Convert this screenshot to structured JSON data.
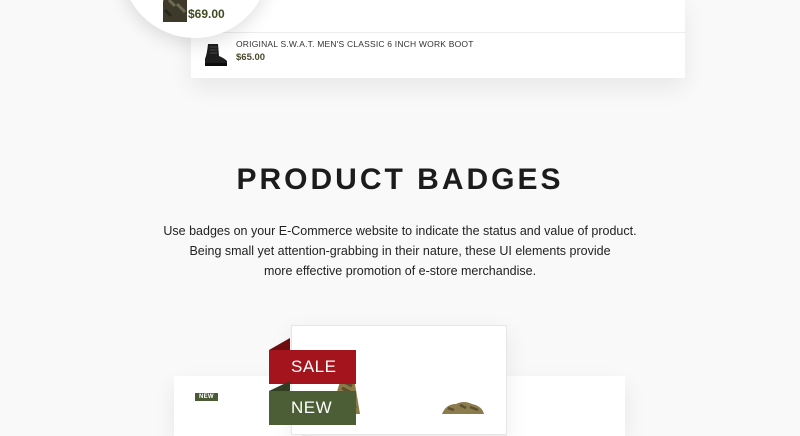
{
  "related_products": {
    "items": [
      {
        "price": "$69.00",
        "partial_price": "00"
      },
      {
        "title": "ORIGINAL S.W.A.T. MEN'S CLASSIC 6 INCH WORK BOOT",
        "price": "$65.00"
      }
    ]
  },
  "badges_section": {
    "title": "PRODUCT BADGES",
    "description_lines": [
      "Use badges on your E-Commerce website to indicate the status and value of product.",
      "Being small yet attention-grabbing in their nature, these UI elements provide",
      "more effective promotion of e-store merchandise."
    ],
    "badges": {
      "sale": "SALE",
      "new": "NEW",
      "small_new": "NEW"
    }
  },
  "colors": {
    "sale_badge": "#a4141c",
    "new_badge": "#4b5e35",
    "price": "#3e4a22"
  }
}
